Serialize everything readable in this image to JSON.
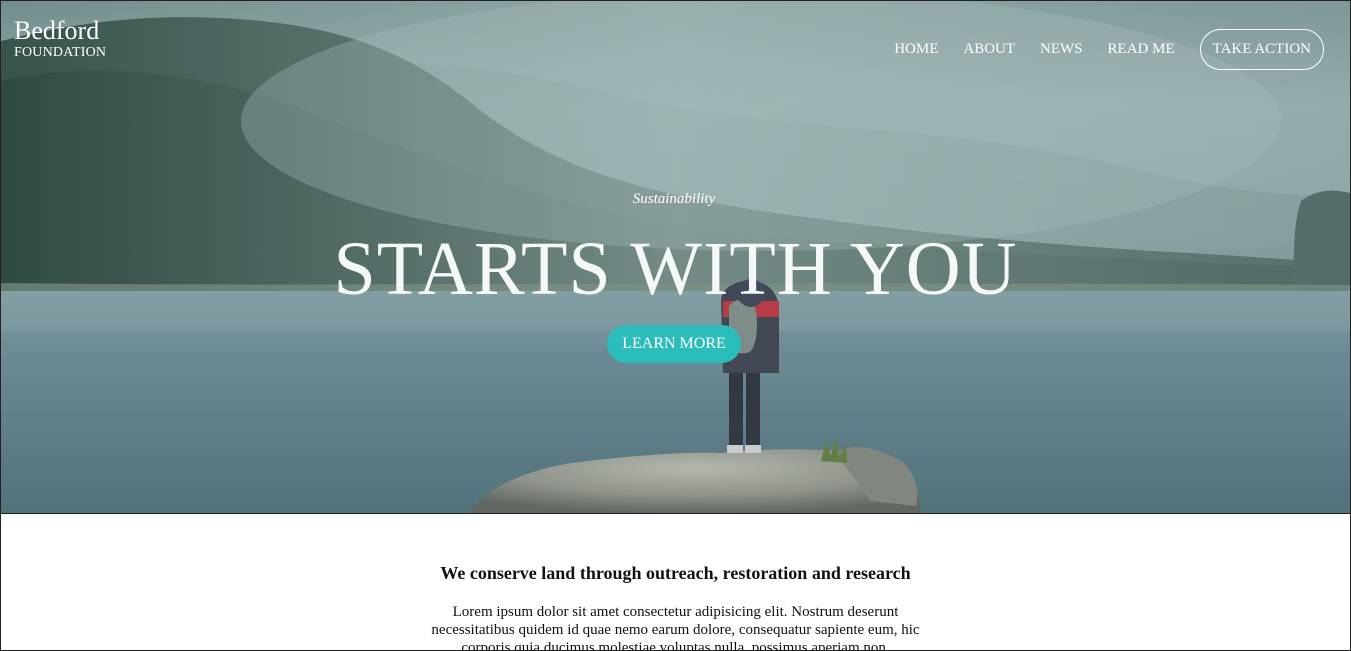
{
  "brand": {
    "name": "Bedford",
    "sub": "FOUNDATION"
  },
  "nav": {
    "items": [
      {
        "label": "HOME"
      },
      {
        "label": "ABOUT"
      },
      {
        "label": "NEWS"
      },
      {
        "label": "READ ME"
      }
    ],
    "cta_label": "TAKE ACTION"
  },
  "hero": {
    "eyebrow": "Sustainability",
    "headline": "STARTS WITH YOU",
    "button_label": "LEARN MORE",
    "colors": {
      "accent": "#2cbdbb",
      "water": "#587a84",
      "forest": "#2f4b43",
      "mist": "#8ea8a7"
    }
  },
  "intro": {
    "title": "We conserve land through outreach, restoration and research",
    "text": "Lorem ipsum dolor sit amet consectetur adipisicing elit. Nostrum deserunt necessitatibus quidem id quae nemo earum dolore, consequatur sapiente eum, hic corporis quia ducimus molestiae voluptas nulla, possimus aperiam non."
  }
}
